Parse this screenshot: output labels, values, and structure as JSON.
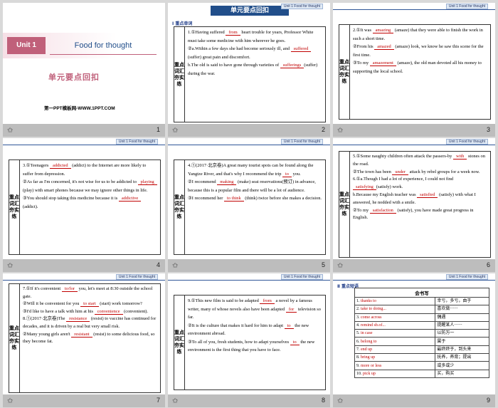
{
  "header_tag": "Unit 1  Food for thought",
  "banner": "单元要点回扣",
  "slides": [
    {
      "num": "1",
      "unit": "Unit 1",
      "title": "Food for thought",
      "subtitle": "单元要点回扣",
      "footer": "第一PPT模板网-WWW.1PPT.COM"
    },
    {
      "num": "2",
      "section": "Ⅰ  重点单词",
      "side": "重点词汇夯实练",
      "lines": [
        {
          "pre": "1.①Having suffered ",
          "ans": "from",
          "post": " heart trouble for years, Professor White must take some medicine with him wherever he goes."
        },
        {
          "pre": "②a.Within a few days she had become seriously ill, and ",
          "ans": "suffered",
          "post": " (suffer) great pain and discomfort."
        },
        {
          "pre": "b.The old is said to have gone through varieties of ",
          "ans": "sufferings",
          "post": "(suffer) during the war."
        }
      ]
    },
    {
      "num": "3",
      "side": "重点词汇夯实练",
      "lines": [
        {
          "pre": "2.①It was ",
          "ans": "amazing",
          "post": " (amaze) that they were able to finish the work in such a short time."
        },
        {
          "pre": "②From his ",
          "ans": "amazed",
          "post": " (amaze) look, we know he saw this scene for the first time."
        },
        {
          "pre": "③To my ",
          "ans": "amazement",
          "post": " (amaze), the old man devoted all his money to supporting the local school."
        }
      ]
    },
    {
      "num": "4",
      "side": "重点词汇夯实练",
      "lines": [
        {
          "pre": "3.①Teenagers ",
          "ans": "addicted",
          "post": " (addict) to the Internet are more likely to suffer from depression."
        },
        {
          "pre": "②As far as I'm concerned, it's not wise for us to be addicted to ",
          "ans": "playing",
          "post": " (play) with smart phones because we may ignore other things in life."
        },
        {
          "pre": "③You should stop taking this medicine because it is ",
          "ans": "addictive",
          "post": " (addict)."
        }
      ]
    },
    {
      "num": "5",
      "side": "重点词汇夯实练",
      "lines": [
        {
          "pre": "4.①(2017·北京卷)A great many tourist spots can be found along the Yangtze River, and that's why I recommend the trip ",
          "ans": "to",
          "post": " you."
        },
        {
          "pre": "②I recommend ",
          "ans": "making",
          "post": " (make) seat reservations(预订) in advance, because this is a popular film and there will be a lot of audience."
        },
        {
          "pre": "③I recommend her ",
          "ans": "to think",
          "post": " (think) twice before she makes a decision."
        }
      ]
    },
    {
      "num": "6",
      "side": "重点词汇夯实练",
      "lines": [
        {
          "pre": "5.①Some naughty children often attack the passers-by ",
          "ans": "with",
          "post": " stones on the road."
        },
        {
          "pre": "②The town has been ",
          "ans": "under",
          "post": " attack by rebel groups for a week now."
        },
        {
          "pre": "6.①a.Though I had a lot of experience, I could not find ",
          "ans": "satisfying",
          "post": "(satisfy) work."
        },
        {
          "pre": "b.Because my English teacher was ",
          "ans": "satisfied",
          "post": " (satisfy) with what I answered, he nodded with a smile."
        },
        {
          "pre": "②To my ",
          "ans": "satisfaction",
          "post": " (satisfy), you have made great progress in English."
        }
      ]
    },
    {
      "num": "7",
      "side": "重点词汇夯实练",
      "lines": [
        {
          "pre": "7.①If it's convenient ",
          "ans": "to/for",
          "post": " you, let's meet at 8:30 outside the school gate."
        },
        {
          "pre": "②Will it be convenient for you ",
          "ans": "to start",
          "post": " (start) work tomorrow?"
        },
        {
          "pre": "③I'd like to have a talk with him at his ",
          "ans": "convenience",
          "post": " (convenient)."
        },
        {
          "pre": "8.①(2017·北京卷)The ",
          "ans": "resistance",
          "post": " (resist) to vaccine has continued for decades, and it is driven by a real but very small risk."
        },
        {
          "pre": "②Many young girls aren't ",
          "ans": "resistant",
          "post": " (resist) to some delicious food, so they become fat."
        }
      ]
    },
    {
      "num": "8",
      "side": "重点词汇夯实练",
      "lines": [
        {
          "pre": "9.①This new film is said to be adapted ",
          "ans": "from",
          "post": " a novel by a famous writer, many of whose novels also have been adapted ",
          "ans2": "for",
          "post2": " television so far."
        },
        {
          "pre": "②It is the culture that makes it hard for him to adapt ",
          "ans": "to",
          "post": " the new environment abroad."
        },
        {
          "pre": "③To all of you, fresh students, how to adapt yourselves ",
          "ans": "to",
          "post": " the new environment is the first thing that you have to face."
        }
      ]
    },
    {
      "num": "9",
      "section": "Ⅱ  重点短语",
      "table_header": "会书写",
      "phrases": [
        {
          "n": "1.",
          "en": "thanks to",
          "zh": "幸亏，多亏，由于"
        },
        {
          "n": "2.",
          "en": "take to doing...",
          "zh": "喜欢做······"
        },
        {
          "n": "3.",
          "en": "come across",
          "zh": "偶遇"
        },
        {
          "n": "4.",
          "en": "remind sb.of...",
          "zh": "提醒某人······"
        },
        {
          "n": "5.",
          "en": "in case",
          "zh": "以防万一"
        },
        {
          "n": "6.",
          "en": "belong to",
          "zh": "属于"
        },
        {
          "n": "7.",
          "en": "end up",
          "zh": "最终终于，到头来"
        },
        {
          "n": "8.",
          "en": "bring up",
          "zh": "抚养，养育；提出"
        },
        {
          "n": "9.",
          "en": "more or less",
          "zh": "或多或少"
        },
        {
          "n": "10.",
          "en": "pick up",
          "zh": "买，购买"
        }
      ]
    }
  ]
}
